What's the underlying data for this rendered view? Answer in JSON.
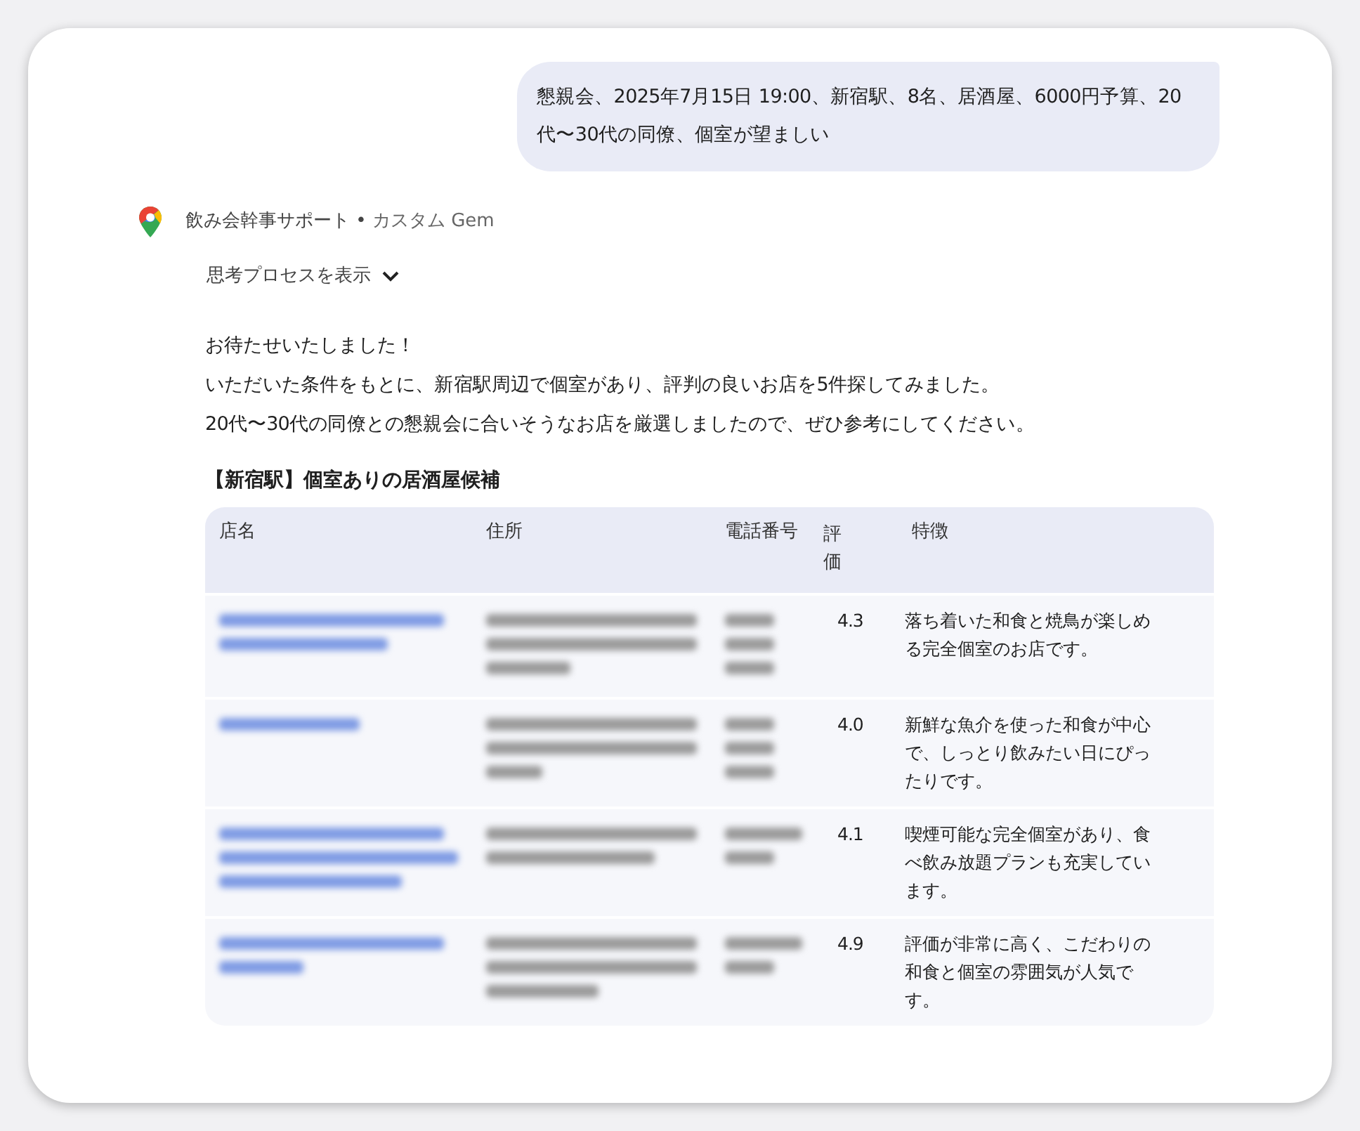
{
  "user_message": "懇親会、2025年7月15日 19:00、新宿駅、8名、居酒屋、6000円予算、20代〜30代の同僚、個室が望ましい",
  "assistant": {
    "name": "飲み会幹事サポート",
    "separator": "•",
    "subtitle": "カスタム Gem",
    "thinking_toggle": "思考プロセスを表示",
    "expanded": false
  },
  "paragraphs": [
    "お待たせいたしました！",
    "いただいた条件をもとに、新宿駅周辺で個室があり、評判の良いお店を5件探してみました。",
    "20代〜30代の同僚との懇親会に合いそうなお店を厳選しましたので、ぜひ参考にしてください。"
  ],
  "table": {
    "title": "【新宿駅】個室ありの居酒屋候補",
    "columns": [
      "店名",
      "住所",
      "電話番号",
      "評価",
      "特徴"
    ],
    "rows": [
      {
        "rating": "4.3",
        "feature": "落ち着いた和食と焼鳥が楽しめる完全個室のお店です。"
      },
      {
        "rating": "4.0",
        "feature": "新鮮な魚介を使った和食が中心で、しっとり飲みたい日にぴったりです。"
      },
      {
        "rating": "4.1",
        "feature": "喫煙可能な完全個室があり、食べ飲み放題プランも充実しています。"
      },
      {
        "rating": "4.9",
        "feature": "評価が非常に高く、こだわりの和食と個室の雰囲気が人気です。"
      }
    ]
  }
}
